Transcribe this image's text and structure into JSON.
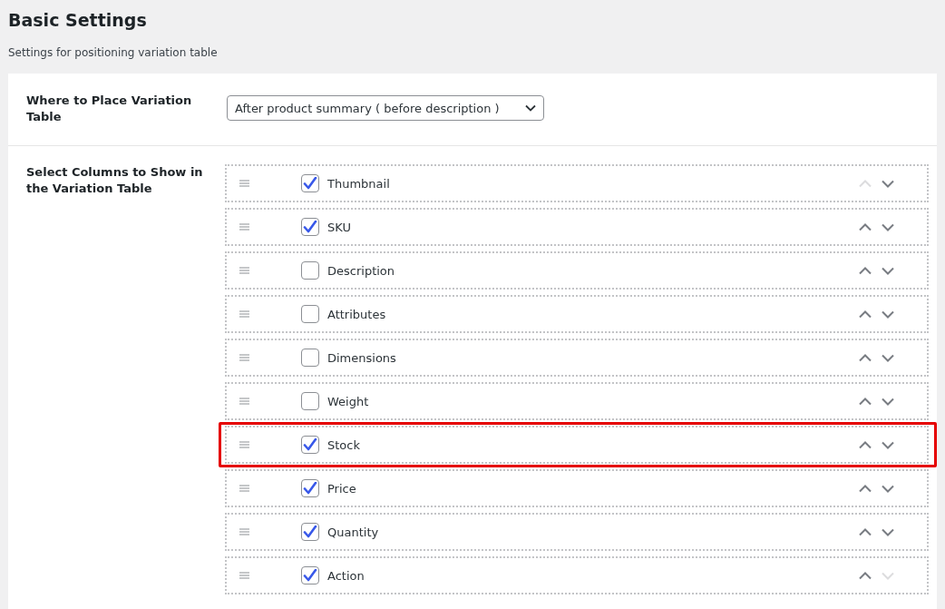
{
  "header": {
    "title": "Basic Settings",
    "description": "Settings for positioning variation table"
  },
  "placement": {
    "label": "Where to Place Variation Table",
    "value": "After product summary ( before description )"
  },
  "columns": {
    "label": "Select Columns to Show in the Variation Table",
    "items": [
      {
        "label": "Thumbnail",
        "checked": true,
        "highlighted": false,
        "up_disabled": true,
        "down_disabled": false
      },
      {
        "label": "SKU",
        "checked": true,
        "highlighted": false,
        "up_disabled": false,
        "down_disabled": false
      },
      {
        "label": "Description",
        "checked": false,
        "highlighted": false,
        "up_disabled": false,
        "down_disabled": false
      },
      {
        "label": "Attributes",
        "checked": false,
        "highlighted": false,
        "up_disabled": false,
        "down_disabled": false
      },
      {
        "label": "Dimensions",
        "checked": false,
        "highlighted": false,
        "up_disabled": false,
        "down_disabled": false
      },
      {
        "label": "Weight",
        "checked": false,
        "highlighted": false,
        "up_disabled": false,
        "down_disabled": false
      },
      {
        "label": "Stock",
        "checked": true,
        "highlighted": true,
        "up_disabled": false,
        "down_disabled": false
      },
      {
        "label": "Price",
        "checked": true,
        "highlighted": false,
        "up_disabled": false,
        "down_disabled": false
      },
      {
        "label": "Quantity",
        "checked": true,
        "highlighted": false,
        "up_disabled": false,
        "down_disabled": false
      },
      {
        "label": "Action",
        "checked": true,
        "highlighted": false,
        "up_disabled": false,
        "down_disabled": true
      }
    ]
  }
}
